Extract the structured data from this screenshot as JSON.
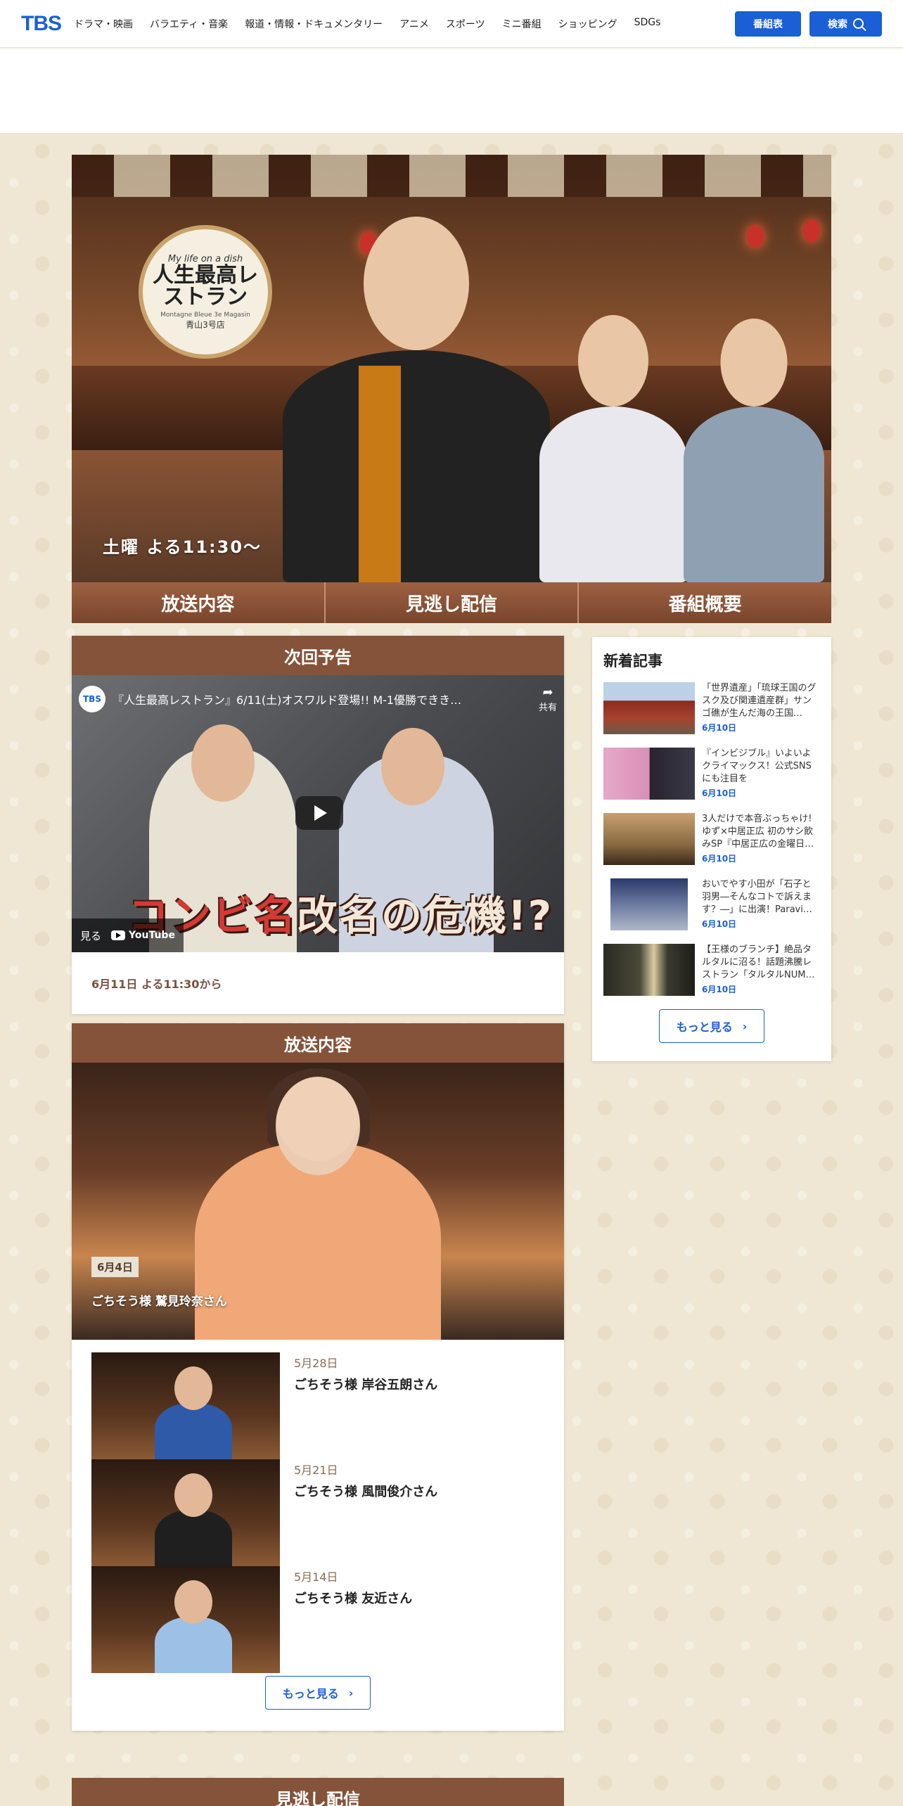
{
  "header": {
    "logo": "TBS",
    "nav": [
      "ドラマ・映画",
      "バラエティ・音楽",
      "報道・情報・ドキュメンタリー",
      "アニメ",
      "スポーツ",
      "ミニ番組",
      "ショッピング",
      "SDGs"
    ],
    "schedule_label": "番組表",
    "search_label": "検索"
  },
  "hero": {
    "logo_tagline": "My life on a dish",
    "logo_title": "人生最高レストラン",
    "logo_subtitle": "Montagne Bleue 3e Magasin",
    "logo_branch": "青山3号店",
    "airtime": "土曜 よる11:30〜",
    "tabs": [
      "放送内容",
      "見逃し配信",
      "番組概要"
    ]
  },
  "next": {
    "title": "次回予告",
    "video_channel": "TBS",
    "video_title": "『人生最高レストラン』6/11(土)オスワルド登場!! M-1優勝できき…",
    "share_label": "共有",
    "headline_red": "コンビ名",
    "headline_white": "改名の危機!?",
    "watch_label": "見る",
    "youtube_label": "YouTube",
    "date_text": "6月11日 よる11:30から"
  },
  "broadcast": {
    "title": "放送内容",
    "featured": {
      "date": "6月4日",
      "guest": "ごちそう様 鷲見玲奈さん"
    },
    "episodes": [
      {
        "date": "5月28日",
        "guest": "ごちそう様 岸谷五朗さん"
      },
      {
        "date": "5月21日",
        "guest": "ごちそう様 風間俊介さん"
      },
      {
        "date": "5月14日",
        "guest": "ごちそう様 友近さん"
      }
    ],
    "more_label": "もっと見る"
  },
  "sidebar": {
    "title": "新着記事",
    "articles": [
      {
        "text": "「世界遺産」「琉球王国のグスク及び関連遺産群」サンゴ礁が生んだ海の王国…",
        "date": "6月10日"
      },
      {
        "text": "『インビジブル』いよいよクライマックス！公式SNSにも注目を",
        "date": "6月10日"
      },
      {
        "text": "3人だけで本音ぶっちゃけ! ゆず×中居正広 初のサシ飲みSP『中居正広の金曜日…",
        "date": "6月10日"
      },
      {
        "text": "おいでやす小田が「石子と羽男―そんなコトで訴えます？―」に出演！Paravi…",
        "date": "6月10日"
      },
      {
        "text": "【王様のブランチ】絶品タルタルに沼る！話題沸騰レストラン「タルタルNUM…",
        "date": "6月10日"
      }
    ],
    "more_label": "もっと見る"
  },
  "missed": {
    "title": "見逃し配信"
  },
  "colors": {
    "accent": "#1a5fd6",
    "section_header": "#84533a",
    "background": "#efe7d3"
  }
}
